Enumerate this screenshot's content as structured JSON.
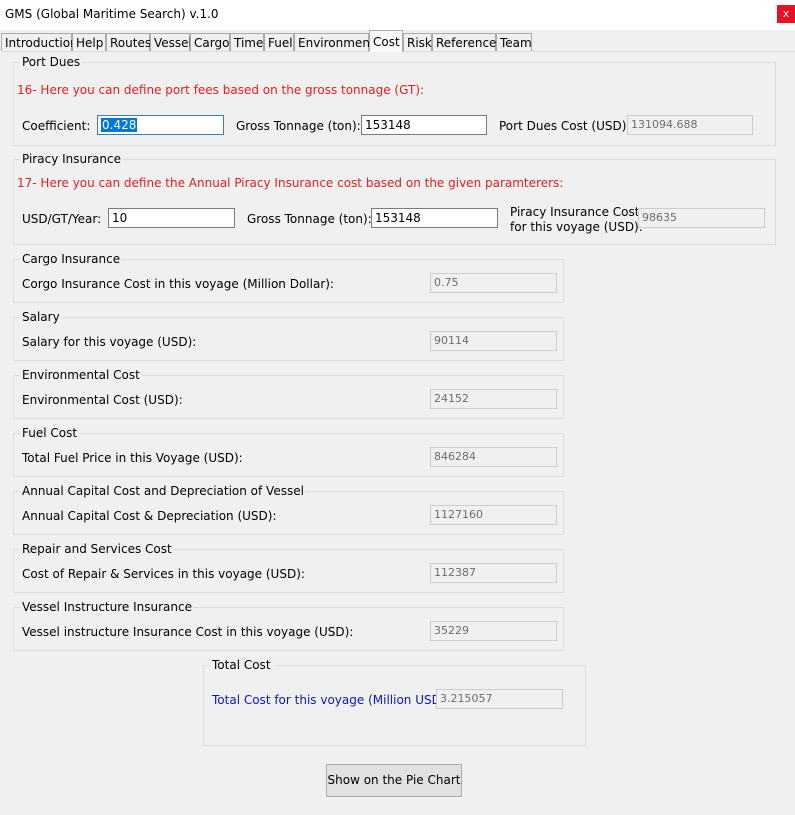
{
  "window": {
    "title": "GMS (Global Maritime Search) v.1.0",
    "close_glyph": "x"
  },
  "tabs": [
    "Introduction",
    "Help",
    "Routes",
    "Vessel",
    "Cargo",
    "Time",
    "Fuel",
    "Environment",
    "Cost",
    "Risk",
    "References",
    "Team"
  ],
  "active_tab": "Cost",
  "port_dues": {
    "title": "Port Dues",
    "instruction": "16- Here you can define port fees based on the gross tonnage (GT):",
    "coefficient_label": "Coefficient:",
    "coefficient_value": "0.428",
    "gross_tonnage_label": "Gross Tonnage (ton):",
    "gross_tonnage_value": "153148",
    "cost_label": "Port Dues Cost (USD):",
    "cost_value": "131094.688"
  },
  "piracy": {
    "title": "Piracy Insurance",
    "instruction": "17- Here you can define the Annual Piracy Insurance cost based on the given paramterers:",
    "rate_label": "USD/GT/Year:",
    "rate_value": "10",
    "gross_tonnage_label": "Gross Tonnage (ton):",
    "gross_tonnage_value": "153148",
    "cost_label_line1": "Piracy Insurance Cost",
    "cost_label_line2": "for this voyage (USD):",
    "cost_value": "98635"
  },
  "cost_groups": [
    {
      "title": "Cargo Insurance",
      "label": "Corgo Insurance Cost in this voyage (Million Dollar):",
      "value": "0.75"
    },
    {
      "title": "Salary",
      "label": "Salary for this voyage (USD):",
      "value": "90114"
    },
    {
      "title": "Environmental Cost",
      "label": "Environmental Cost (USD):",
      "value": "24152"
    },
    {
      "title": "Fuel Cost",
      "label": "Total Fuel Price in this Voyage (USD):",
      "value": "846284"
    },
    {
      "title": "Annual Capital Cost and Depreciation of Vessel",
      "label": "Annual Capital Cost & Depreciation (USD):",
      "value": "1127160"
    },
    {
      "title": "Repair and Services Cost",
      "label": "Cost of Repair & Services in this voyage (USD):",
      "value": "112387"
    },
    {
      "title": "Vessel Instructure Insurance",
      "label": "Vessel instructure Insurance Cost in this voyage (USD):",
      "value": "35229"
    }
  ],
  "total": {
    "title": "Total Cost",
    "label": "Total Cost for this voyage (Million USD):",
    "value": "3.215057"
  },
  "pie_button_label": "Show on the Pie Chart",
  "colors": {
    "instruction": "#e02020",
    "total_label": "#1515b0",
    "close_button": "#e81123",
    "selection": "#0078d7"
  }
}
